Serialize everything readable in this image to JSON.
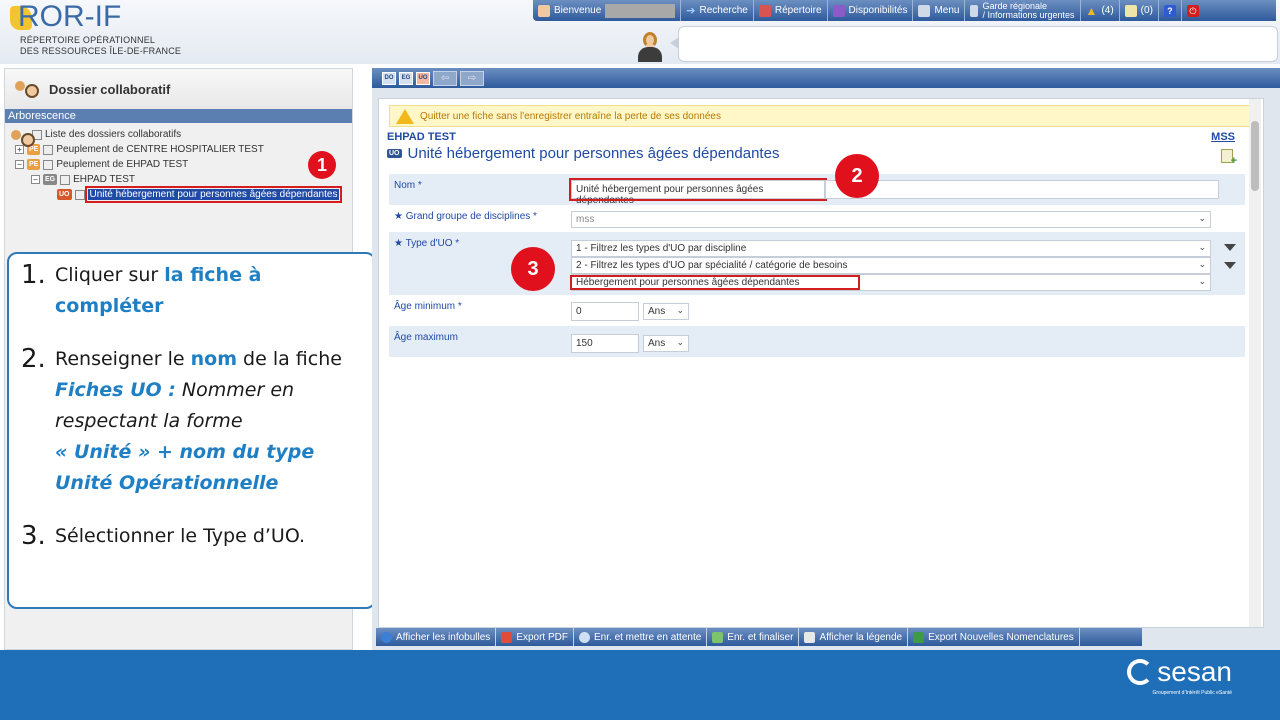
{
  "header": {
    "logo_brand": "ROR-IF",
    "logo_sub1": "RÉPERTOIRE OPÉRATIONNEL",
    "logo_sub2": "DES RESSOURCES ÎLE-DE-FRANCE",
    "nav": {
      "welcome": "Bienvenue",
      "search": "Recherche",
      "directory": "Répertoire",
      "availability": "Disponibilités",
      "menu": "Menu",
      "garde_line1": "Garde régionale",
      "garde_line2": "/ Informations urgentes",
      "alerts_count": "(4)",
      "messages_count": "(0)"
    },
    "colors": {
      "nav_bar": "#2e5a9c",
      "accent_red": "#e0101d"
    }
  },
  "left_panel": {
    "title": "Dossier collaboratif",
    "bar_label": "Arborescence",
    "tree": {
      "root": "Liste des dossiers collaboratifs",
      "node1": "Peuplement de CENTRE HOSPITALIER TEST",
      "node2": "Peuplement de EHPAD TEST",
      "node2_child": "EHPAD TEST",
      "node2_child_badge": "EG",
      "selected_badge": "UO",
      "selected": "Unité hébergement pour personnes âgées dépendantes",
      "badge_do": "DO",
      "badge_pe": "PE"
    }
  },
  "badges": {
    "one": "1",
    "two": "2",
    "three": "3"
  },
  "instructions": {
    "step1_num": "1.",
    "step1_pre": "Cliquer sur ",
    "step1_hl": "la fiche à compléter",
    "step2_num": "2.",
    "step2_pre": "Renseigner le ",
    "step2_hl": "nom",
    "step2_post": " de la fiche",
    "step2_uo_label": "Fiches UO :",
    "step2_uo_text": " Nommer en respectant la forme",
    "step2_form": "« Unité » + nom du type Unité Opérationnelle",
    "step3_num": "3.",
    "step3_text": "Sélectionner le Type d’UO."
  },
  "right_panel": {
    "toolbar": {
      "b1": "DO",
      "b2": "EG",
      "b3": "UO",
      "back": "⇦",
      "fwd": "⇨"
    },
    "warning": "Quitter une fiche sans l'enregistrer entraîne la perte de ses données",
    "org": "EHPAD TEST",
    "mss": "MSS",
    "unit_badge": "UO",
    "unit_title": "Unité hébergement pour personnes âgées dépendantes",
    "form": {
      "nom_label": "Nom *",
      "nom_value": "Unité hébergement pour personnes âgées dépendantes",
      "groupe_label": "Grand groupe de disciplines *",
      "groupe_value": "mss",
      "type_label": "Type d'UO *",
      "type_filter1": "1 - Filtrez les types d'UO par discipline",
      "type_filter2": "2 - Filtrez les types d'UO par spécialité / catégorie de besoins",
      "type_value": "Hébergement pour personnes âgées dépendantes",
      "age_min_label": "Âge minimum *",
      "age_min_value": "0",
      "age_min_unit": "Ans",
      "age_max_label": "Âge maximum",
      "age_max_value": "150",
      "age_max_unit": "Ans"
    },
    "bottom": {
      "infobulles": "Afficher les infobulles",
      "export_pdf": "Export PDF",
      "save_wait": "Enr. et mettre en attente",
      "save_finish": "Enr. et finaliser",
      "legend": "Afficher la légende",
      "export_nomenc": "Export Nouvelles Nomenclatures"
    }
  },
  "footer": {
    "brand": "sesan",
    "tagline": "Groupement d’Intérêt Public eSanté"
  }
}
